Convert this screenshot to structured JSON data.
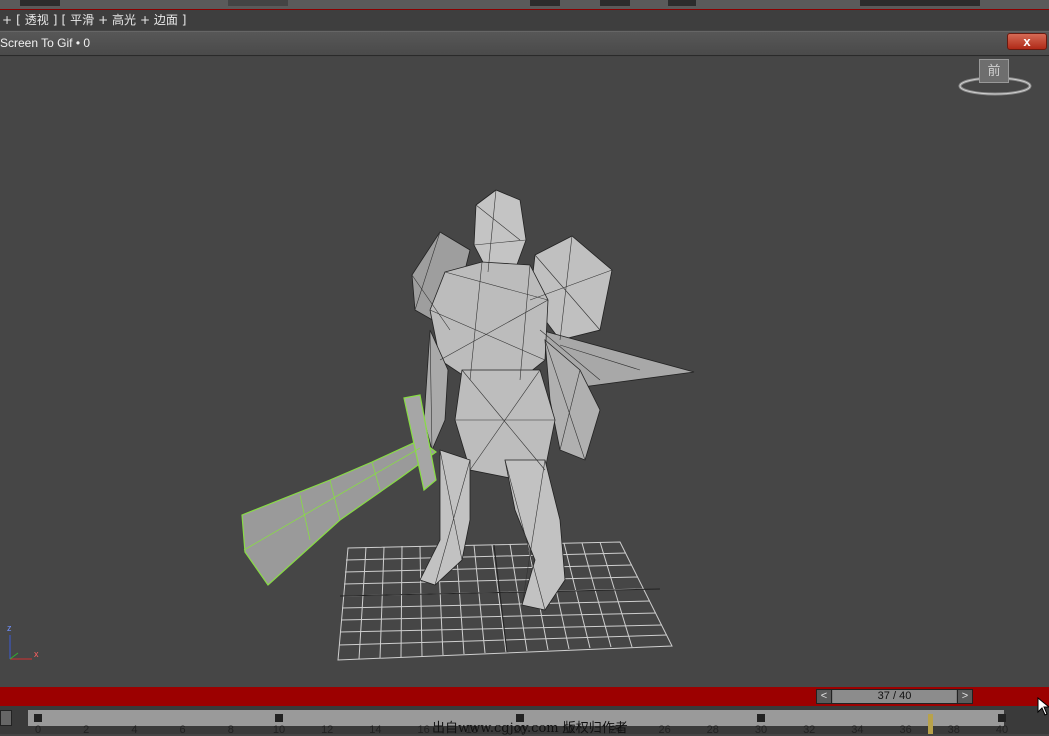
{
  "viewport_label": {
    "plus": "+",
    "bracket_open": "[",
    "view": "透视",
    "bracket_close": "]",
    "shading_bracket": "[",
    "shading": "平滑",
    "highlight": "+ 高光",
    "edged_faces": "+ 边面 ]"
  },
  "gif_window": {
    "title": "Screen To Gif • 0",
    "close_label": "x"
  },
  "viewcube": {
    "face_label": "前"
  },
  "axis_gizmo": {
    "z_label": "z",
    "x_label": "x"
  },
  "time_slider": {
    "frame_text": "37 / 40",
    "prev": "<",
    "next": ">",
    "current_frame": 37,
    "total_frames": 40
  },
  "timeline": {
    "tick_labels": [
      "0",
      "2",
      "4",
      "6",
      "8",
      "10",
      "12",
      "14",
      "16",
      "18",
      "20",
      "22",
      "24",
      "26",
      "28",
      "30",
      "32",
      "34",
      "36",
      "38",
      "40"
    ]
  },
  "watermark": "出自www.cgjoy.com 版权归作者",
  "colors": {
    "background": "#444444",
    "selection_wire": "#88dd44",
    "timeline_red": "#9c0000"
  }
}
